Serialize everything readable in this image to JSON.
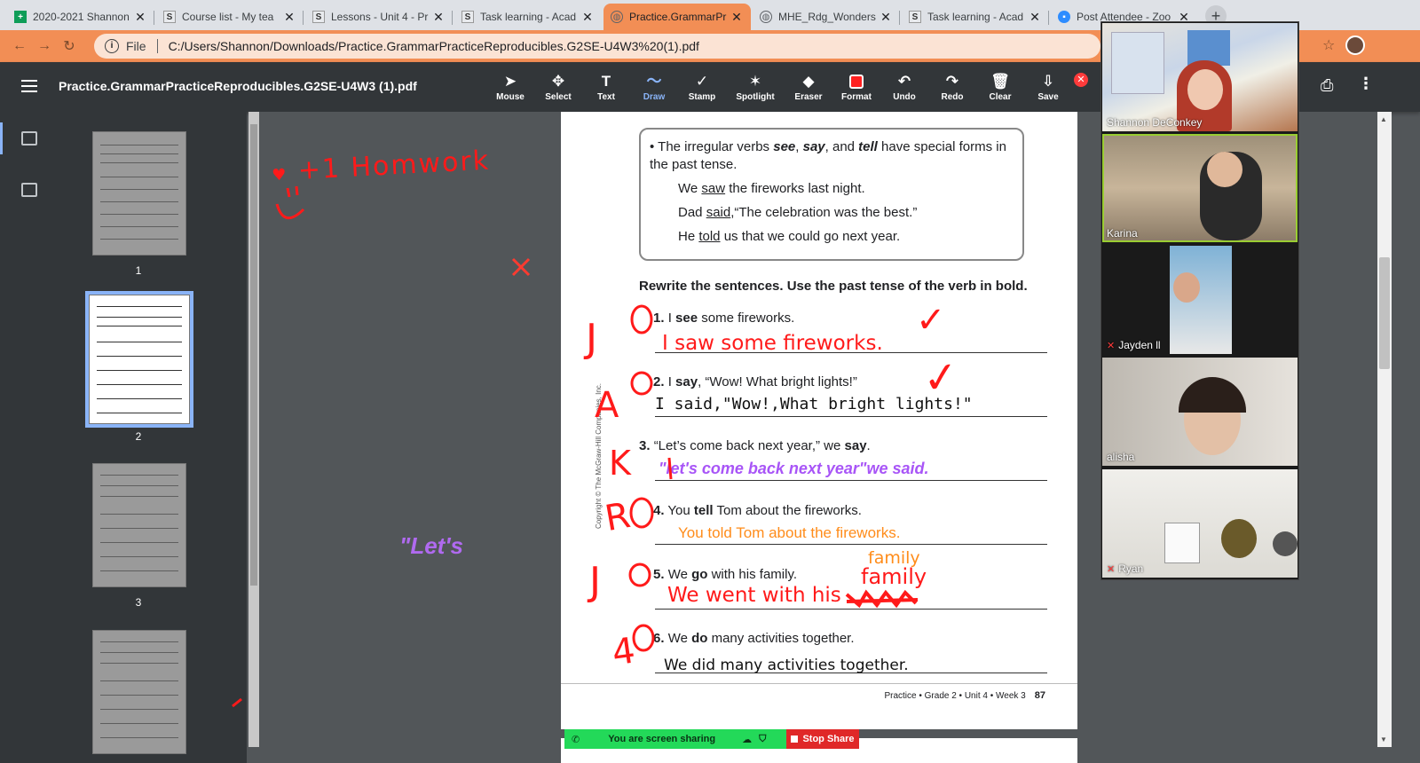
{
  "browser": {
    "tabs": [
      {
        "title": "2020-2021 Shannon",
        "icon": "sheets-icon",
        "color": "#0f9d58"
      },
      {
        "title": "Course list - My tea",
        "icon": "schoology-icon",
        "color": "#5f6368"
      },
      {
        "title": "Lessons - Unit 4 - Pr",
        "icon": "schoology-icon",
        "color": "#5f6368"
      },
      {
        "title": "Task learning - Acad",
        "icon": "schoology-icon",
        "color": "#5f6368"
      },
      {
        "title": "Practice.GrammarPr",
        "icon": "globe-icon",
        "color": "#5f6368"
      },
      {
        "title": "MHE_Rdg_Wonders",
        "icon": "globe-icon",
        "color": "#5f6368"
      },
      {
        "title": "Task learning - Acad",
        "icon": "schoology-icon",
        "color": "#5f6368"
      },
      {
        "title": "Post Attendee - Zoo",
        "icon": "zoom-icon",
        "color": "#2d8cff"
      }
    ],
    "new_tab": "+",
    "address": {
      "scheme_label": "File",
      "url": "C:/Users/Shannon/Downloads/Practice.GrammarPracticeReproducibles.G2SE-U4W3%20(1).pdf"
    }
  },
  "pdf": {
    "title": "Practice.GrammarPracticeReproducibles.G2SE-U4W3 (1).pdf",
    "tools": [
      {
        "label": "Mouse",
        "glyph": "➤"
      },
      {
        "label": "Select",
        "glyph": "✥"
      },
      {
        "label": "Text",
        "glyph": "T"
      },
      {
        "label": "Draw",
        "glyph": "〜"
      },
      {
        "label": "Stamp",
        "glyph": "✓"
      },
      {
        "label": "Spotlight",
        "glyph": "✶"
      },
      {
        "label": "Eraser",
        "glyph": "◆"
      },
      {
        "label": "Format",
        "glyph": ""
      },
      {
        "label": "Undo",
        "glyph": "↶"
      },
      {
        "label": "Redo",
        "glyph": "↷"
      },
      {
        "label": "Clear",
        "glyph": "🗑"
      },
      {
        "label": "Save",
        "glyph": "⇩"
      }
    ],
    "thumb_pages": [
      "1",
      "2",
      "3"
    ],
    "colors": {
      "accent": "#8ab4f8",
      "annotation_red": "#ff1a1a",
      "annotation_purple": "#a855f7",
      "annotation_orange": "#ff8c1a"
    }
  },
  "page": {
    "rule": {
      "bullet": "•",
      "pre": "The irregular verbs ",
      "v1": "see",
      "comma1": ", ",
      "v2": "say",
      "and": ", and ",
      "v3": "tell",
      "post": " have special forms in the past tense."
    },
    "examples": [
      {
        "pre": "We ",
        "verb": "saw",
        "post": " the fireworks last night."
      },
      {
        "pre": "Dad ",
        "verb": "said",
        "post": ",“The celebration was the best.”"
      },
      {
        "pre": "He ",
        "verb": "told",
        "post": " us that we could go next year."
      }
    ],
    "instruction": "Rewrite the sentences. Use the past tense of the verb in bold.",
    "questions": [
      {
        "num": "1.",
        "pre": "I ",
        "verb": "see",
        "post": " some fireworks."
      },
      {
        "num": "2.",
        "pre": "I ",
        "verb": "say",
        "post": ", “Wow! What bright lights!”"
      },
      {
        "num": "3.",
        "pre": "“Let’s come back next year,” we ",
        "verb": "say",
        "post": "."
      },
      {
        "num": "4.",
        "pre": "You ",
        "verb": "tell",
        "post": " Tom about the fireworks."
      },
      {
        "num": "5.",
        "pre": "We ",
        "verb": "go",
        "post": " with his family."
      },
      {
        "num": "6.",
        "pre": "We ",
        "verb": "do",
        "post": " many activities together."
      }
    ],
    "answers": [
      "I saw some fireworks.",
      "I said,\"Wow!,What bright lights!\"",
      "\"let's come back next year\"we said.",
      "You told Tom about the fireworks.",
      "We went with his",
      "We did many activities together."
    ],
    "footer": {
      "text": "Practice • Grade 2 • Unit 4 • Week 3",
      "page": "87"
    },
    "copyright": "Copyright © The McGraw-Hill Companies, Inc."
  },
  "annotations": {
    "homework": "+1 Homwork",
    "lets": "\"Let's",
    "family_small": "family",
    "family_big": "family",
    "initials": [
      "J",
      "A",
      "K",
      "R",
      "J",
      "4"
    ],
    "check": "✓"
  },
  "zoom": {
    "participants": [
      {
        "name": "Shannon DeConkey",
        "muted": false
      },
      {
        "name": "Karina",
        "muted": false
      },
      {
        "name": "Jayden ll",
        "muted": true
      },
      {
        "name": "alisha",
        "muted": false
      },
      {
        "name": "Ryan",
        "muted": true
      }
    ],
    "share_text": "You are screen sharing",
    "stop_share": "Stop Share"
  }
}
